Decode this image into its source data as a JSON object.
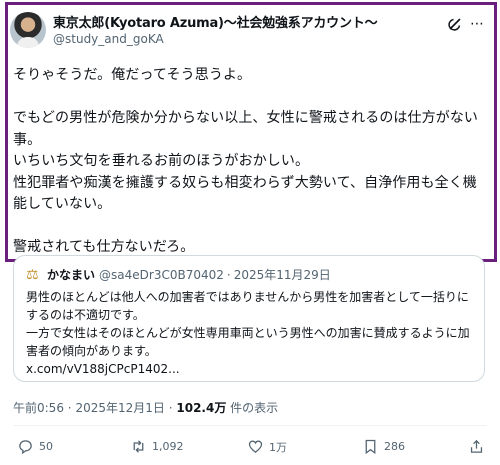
{
  "author": {
    "display_name": "東京太郎(Kyotaro Azuma)〜社会勉強系アカウント〜",
    "handle": "@study_and_goKA",
    "avatar_icon": "profile-photo"
  },
  "post": {
    "text": "そりゃそうだ。俺だってそう思うよ。\n\nでもどの男性が危険か分からない以上、女性に警戒されるのは仕方がない事。\nいちいち文句を垂れるお前のほうがおかしい。\n性犯罪者や痴漢を擁護する奴らも相変わらず大勢いて、自浄作用も全く機能していない。\n\n警戒されても仕方ないだろ。"
  },
  "quote": {
    "icon": "scales-icon",
    "name": "かなまい",
    "handle": "@sa4eDr3C0B70402",
    "separator": "·",
    "date": "2025年11月29日",
    "text": "男性のほとんどは他人への加害者ではありませんから男性を加害者として一括りにするのは不適切です。\n一方で女性はそのほとんどが女性専用車両という男性への加害に賛成するように加害者の傾向があります。",
    "link": "x.com/vV188jCPcP1402..."
  },
  "meta": {
    "time": "午前0:56",
    "separator": "·",
    "date": "2025年12月1日",
    "views": "102.4万",
    "views_suffix": "件の表示"
  },
  "actions": {
    "replies": "50",
    "reposts": "1,092",
    "likes": "1万",
    "bookmarks": "286"
  },
  "colors": {
    "highlight_border": "#6b1f7c",
    "secondary_text": "#536471",
    "primary_text": "#0f1419"
  }
}
